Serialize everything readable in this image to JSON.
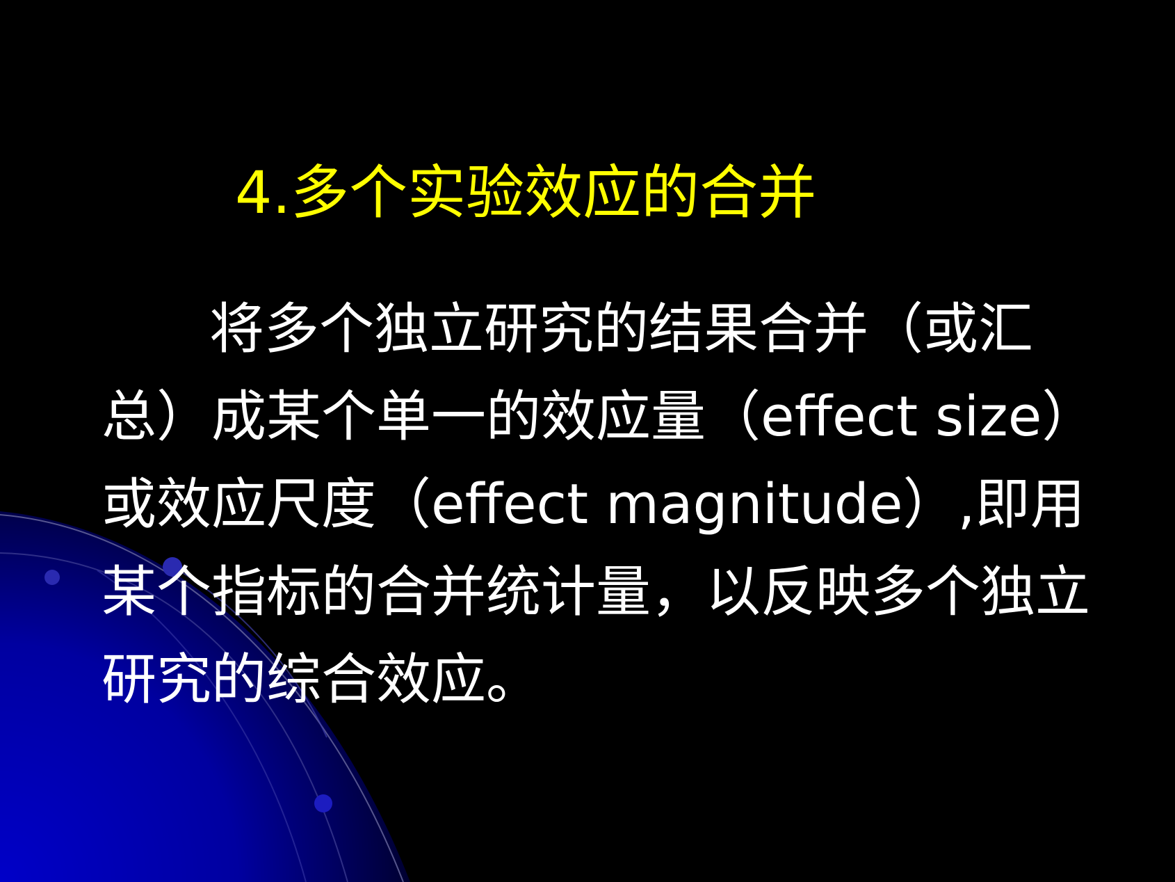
{
  "slide": {
    "title": "4.多个实验效应的合并",
    "body": "将多个独立研究的结果合并（或汇总）成某个单一的效应量（effect size）或效应尺度（effect magnitude）,即用某个指标的合并统计量，以反映多个独立研究的综合效应。"
  },
  "colors": {
    "background": "#000000",
    "title": "#ffff00",
    "body_text": "#ffffff",
    "accent_blue": "#0000c8"
  }
}
